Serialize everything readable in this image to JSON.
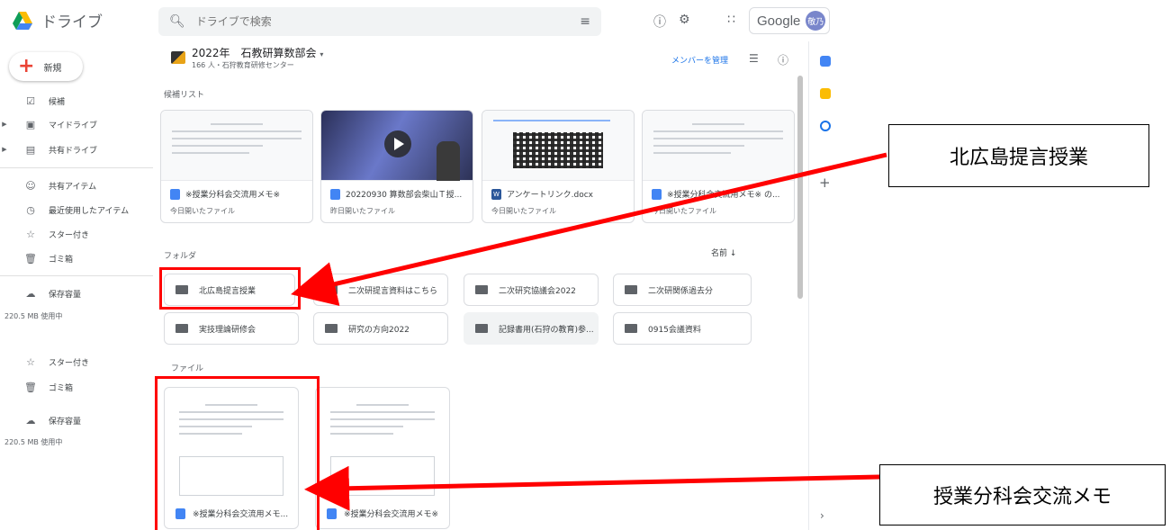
{
  "header": {
    "app_name": "ドライブ",
    "search_placeholder": "ドライブで検索",
    "account_label": "Google",
    "avatar_text": "敬乃"
  },
  "sidebar": {
    "new_label": "新規",
    "items": [
      {
        "label": "候補",
        "icon": "check-circle-icon"
      },
      {
        "label": "マイドライブ",
        "icon": "my-drive-icon"
      },
      {
        "label": "共有ドライブ",
        "icon": "shared-drive-icon"
      },
      {
        "label": "共有アイテム",
        "icon": "people-icon"
      },
      {
        "label": "最近使用したアイテム",
        "icon": "clock-icon"
      },
      {
        "label": "スター付き",
        "icon": "star-icon"
      },
      {
        "label": "ゴミ箱",
        "icon": "trash-icon"
      },
      {
        "label": "保存容量",
        "icon": "cloud-icon"
      }
    ],
    "storage_used": "220.5 MB 使用中",
    "dup_items": [
      {
        "label": "スター付き"
      },
      {
        "label": "ゴミ箱"
      },
      {
        "label": "保存容量"
      }
    ],
    "dup_storage_used": "220.5 MB 使用中"
  },
  "drive": {
    "title": "2022年　石教研算数部会",
    "subtitle": "166 人・石狩教育研修センター",
    "manage_members": "メンバーを管理"
  },
  "suggested": {
    "label": "候補リスト",
    "cards": [
      {
        "name": "※授業分科会交流用メモ※",
        "sub": "今日開いたファイル",
        "type": "doc"
      },
      {
        "name": "20220930 算数部会柴山Ｔ授...",
        "sub": "昨日開いたファイル",
        "type": "video"
      },
      {
        "name": "アンケートリンク.docx",
        "sub": "今日開いたファイル",
        "type": "word"
      },
      {
        "name": "※授業分科会交流用メモ※ の...",
        "sub": "今日開いたファイル",
        "type": "doc"
      }
    ]
  },
  "folders": {
    "label": "フォルダ",
    "sort_label": "名前",
    "items": [
      {
        "name": "北広島提言授業"
      },
      {
        "name": "二次研提言資料はこちら"
      },
      {
        "name": "二次研究協議会2022"
      },
      {
        "name": "二次研関係過去分"
      },
      {
        "name": "実技理論研修会"
      },
      {
        "name": "研究の方向2022"
      },
      {
        "name": "記録書用(石狩の教育)参..."
      },
      {
        "name": "0915会議資料"
      }
    ]
  },
  "files": {
    "label": "ファイル",
    "items": [
      {
        "name": "※授業分科会交流用メモ..."
      },
      {
        "name": "※授業分科会交流用メモ※"
      }
    ]
  },
  "annotations": {
    "callout_folder": "北広島提言授業",
    "callout_file": "授業分科会交流メモ",
    "color": "#ff0000"
  }
}
